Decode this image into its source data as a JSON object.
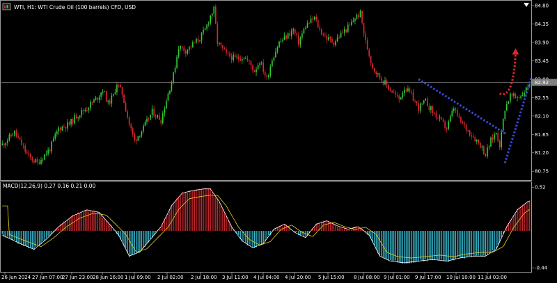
{
  "window": {
    "title": "WTI, H1:  WTI Crude Oil (100 barrels) CFD, USD",
    "subtitle": "MACD(12,26,9) 0.27 0.16 0.21 0.00"
  },
  "chart_data": {
    "type": "candlestick",
    "symbol": "WTI",
    "timeframe": "H1",
    "colors": {
      "background": "#000000",
      "bull": "#33cc33",
      "bear": "#e0262d",
      "bid_line": "#808080",
      "price_box": "#808080",
      "trendline": "#3a4bd8",
      "arrow": "#e0262d",
      "macd_pos": "#c0272d",
      "macd_neg": "#38b3c9",
      "macd_main": "#ffffff",
      "macd_signal": "#e6d21e"
    },
    "price_axis": {
      "ticks": [
        "84.80",
        "84.35",
        "83.90",
        "83.45",
        "83.00",
        "82.55",
        "82.10",
        "81.65",
        "81.20",
        "80.75"
      ],
      "ylim": [
        80.55,
        84.9
      ],
      "current_price": "82.92"
    },
    "time_axis": {
      "ticks": [
        "26 Jun 2024",
        "27 Jun 07:00",
        "27 Jun 23:00",
        "28 Jun 16:00",
        "1 Jul 09:00",
        "2 Jul 02:00",
        "2 Jul 18:00",
        "3 Jul 11:00",
        "4 Jul 04:00",
        "4 Jul 20:00",
        "5 Jul 15:00",
        "8 Jul 08:00",
        "9 Jul 01:00",
        "9 Jul 17:00",
        "10 Jul 10:00",
        "11 Jul 03:00"
      ]
    },
    "macd_axis": {
      "ticks": [
        "0.52",
        "-0.44"
      ],
      "ylim": [
        -0.48,
        0.58
      ]
    },
    "macd_params": [
      12,
      26,
      9
    ],
    "macd_values": {
      "main": 0.27,
      "signal": 0.16,
      "osma": 0.21,
      "extra": 0.0
    },
    "price_path": [
      [
        0,
        81.4
      ],
      [
        7,
        81.7
      ],
      [
        15,
        81.1
      ],
      [
        20,
        80.95
      ],
      [
        27,
        81.3
      ],
      [
        32,
        81.8
      ],
      [
        38,
        81.9
      ],
      [
        42,
        82.1
      ],
      [
        48,
        82.3
      ],
      [
        54,
        82.55
      ],
      [
        57,
        82.75
      ],
      [
        60,
        82.4
      ],
      [
        63,
        82.6
      ],
      [
        65,
        82.9
      ],
      [
        68,
        82.65
      ],
      [
        72,
        81.9
      ],
      [
        75,
        81.5
      ],
      [
        80,
        81.8
      ],
      [
        85,
        82.2
      ],
      [
        90,
        82.0
      ],
      [
        93,
        82.5
      ],
      [
        97,
        83.1
      ],
      [
        100,
        83.8
      ],
      [
        104,
        83.7
      ],
      [
        108,
        83.85
      ],
      [
        112,
        84.0
      ],
      [
        115,
        84.2
      ],
      [
        118,
        84.55
      ],
      [
        120,
        84.7
      ],
      [
        122,
        83.9
      ],
      [
        127,
        83.6
      ],
      [
        132,
        83.5
      ],
      [
        137,
        83.55
      ],
      [
        140,
        83.4
      ],
      [
        143,
        83.2
      ],
      [
        146,
        83.45
      ],
      [
        150,
        83.0
      ],
      [
        153,
        83.5
      ],
      [
        157,
        83.9
      ],
      [
        160,
        84.0
      ],
      [
        165,
        84.2
      ],
      [
        168,
        83.9
      ],
      [
        172,
        84.3
      ],
      [
        177,
        84.5
      ],
      [
        180,
        84.2
      ],
      [
        184,
        84.0
      ],
      [
        188,
        83.9
      ],
      [
        192,
        84.1
      ],
      [
        197,
        84.3
      ],
      [
        200,
        84.5
      ],
      [
        203,
        84.6
      ],
      [
        206,
        83.9
      ],
      [
        210,
        83.3
      ],
      [
        213,
        83.1
      ],
      [
        217,
        82.9
      ],
      [
        221,
        82.7
      ],
      [
        225,
        82.5
      ],
      [
        228,
        82.8
      ],
      [
        232,
        82.6
      ],
      [
        236,
        82.3
      ],
      [
        240,
        82.45
      ],
      [
        244,
        82.2
      ],
      [
        248,
        82.0
      ],
      [
        252,
        81.8
      ],
      [
        256,
        82.3
      ],
      [
        259,
        82.0
      ],
      [
        263,
        81.8
      ],
      [
        267,
        81.6
      ],
      [
        271,
        81.4
      ],
      [
        274,
        81.15
      ],
      [
        277,
        81.5
      ],
      [
        280,
        81.7
      ],
      [
        282,
        81.4
      ],
      [
        285,
        82.3
      ],
      [
        288,
        82.6
      ],
      [
        291,
        82.55
      ],
      [
        294,
        82.6
      ],
      [
        297,
        82.75
      ],
      [
        299,
        82.92
      ]
    ],
    "macd_path": [
      [
        0,
        -0.05
      ],
      [
        10,
        -0.15
      ],
      [
        18,
        -0.22
      ],
      [
        25,
        -0.1
      ],
      [
        32,
        0.05
      ],
      [
        40,
        0.18
      ],
      [
        48,
        0.25
      ],
      [
        55,
        0.22
      ],
      [
        60,
        0.1
      ],
      [
        66,
        -0.05
      ],
      [
        72,
        -0.3
      ],
      [
        78,
        -0.25
      ],
      [
        84,
        -0.1
      ],
      [
        90,
        0.05
      ],
      [
        96,
        0.3
      ],
      [
        102,
        0.45
      ],
      [
        108,
        0.48
      ],
      [
        114,
        0.5
      ],
      [
        118,
        0.5
      ],
      [
        123,
        0.35
      ],
      [
        130,
        0.05
      ],
      [
        136,
        -0.12
      ],
      [
        142,
        -0.2
      ],
      [
        148,
        -0.15
      ],
      [
        154,
        0.02
      ],
      [
        160,
        0.08
      ],
      [
        166,
        -0.02
      ],
      [
        172,
        -0.08
      ],
      [
        178,
        0.08
      ],
      [
        184,
        0.12
      ],
      [
        190,
        0.06
      ],
      [
        196,
        0.02
      ],
      [
        202,
        0.05
      ],
      [
        208,
        -0.05
      ],
      [
        214,
        -0.3
      ],
      [
        220,
        -0.36
      ],
      [
        228,
        -0.38
      ],
      [
        236,
        -0.36
      ],
      [
        244,
        -0.34
      ],
      [
        252,
        -0.36
      ],
      [
        260,
        -0.32
      ],
      [
        268,
        -0.3
      ],
      [
        274,
        -0.3
      ],
      [
        280,
        -0.22
      ],
      [
        286,
        0.05
      ],
      [
        292,
        0.25
      ],
      [
        298,
        0.35
      ]
    ]
  }
}
